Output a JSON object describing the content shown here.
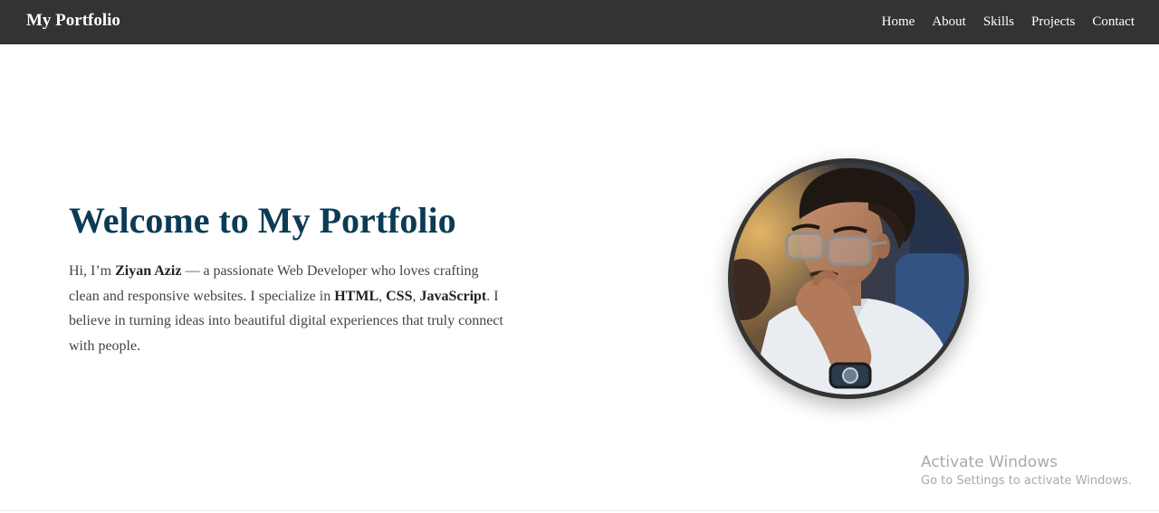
{
  "navbar": {
    "brand": "My Portfolio",
    "links": [
      {
        "label": "Home"
      },
      {
        "label": "About"
      },
      {
        "label": "Skills"
      },
      {
        "label": "Projects"
      },
      {
        "label": "Contact"
      }
    ]
  },
  "hero": {
    "title": "Welcome to My Portfolio",
    "intro_1": "Hi, I’m ",
    "name": "Ziyan Aziz",
    "intro_2": " — a passionate Web Developer who loves crafting clean and responsive websites. I specialize in ",
    "skill_1": "HTML",
    "sep_1": ", ",
    "skill_2": "CSS",
    "sep_2": ", ",
    "skill_3": "JavaScript",
    "intro_3": ". I believe in turning ideas into beautiful digital experiences that truly connect with people."
  },
  "watermark": {
    "title": "Activate Windows",
    "subtitle": "Go to Settings to activate Windows."
  },
  "colors": {
    "navbar_bg": "#333333",
    "title": "#0b3b55",
    "body_text": "#444444",
    "avatar_border": "#333333"
  }
}
